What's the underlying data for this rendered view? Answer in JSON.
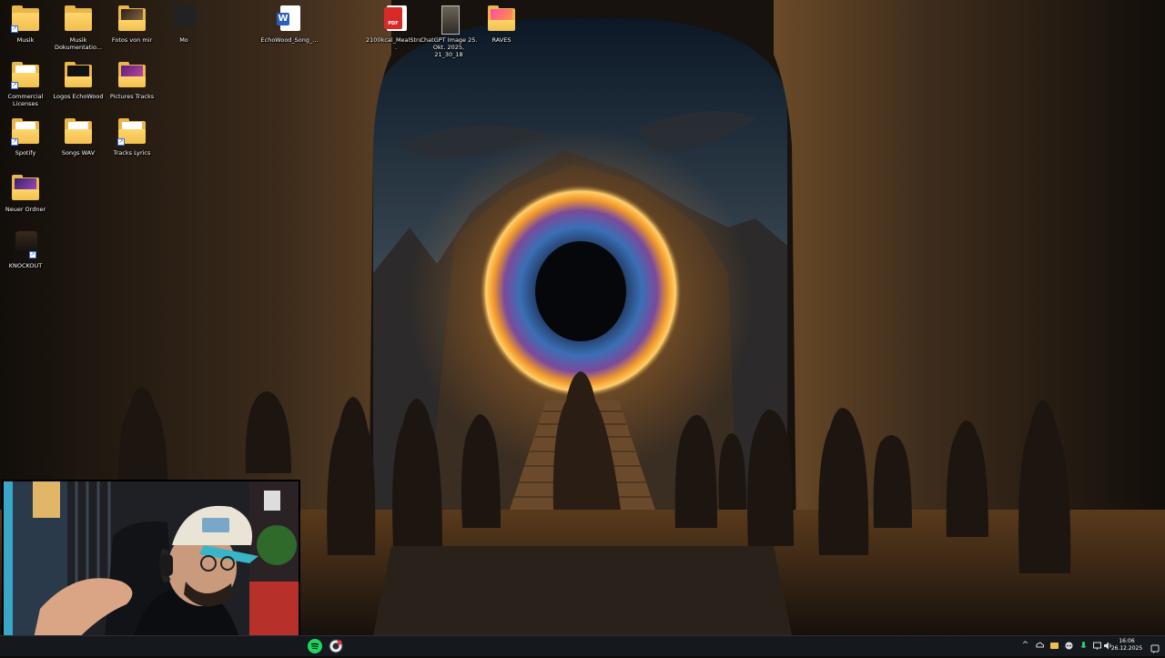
{
  "desktop": {
    "icons": [
      {
        "label": "Musik",
        "kind": "folder",
        "shortcut": true
      },
      {
        "label": "Musik Dokumentatio...",
        "kind": "folder"
      },
      {
        "label": "Fotos von mir",
        "kind": "folder-photo"
      },
      {
        "label": "Mo",
        "kind": "app-dark"
      },
      {
        "label": "EchoWood_Song_...",
        "kind": "word"
      },
      {
        "label": "2100kcal_MealStru...",
        "kind": "pdf"
      },
      {
        "label": "ChatGPT Image 25. Okt. 2025, 21_30_18",
        "kind": "image"
      },
      {
        "label": "RAVES",
        "kind": "folder-pink"
      },
      {
        "label": "Commercial Licenses",
        "kind": "folder",
        "shortcut": true
      },
      {
        "label": "Logos EchoWood",
        "kind": "folder-dark"
      },
      {
        "label": "Pictures Tracks",
        "kind": "folder-purple"
      },
      {
        "label": "Spotify",
        "kind": "folder",
        "shortcut": true
      },
      {
        "label": "Songs WAV",
        "kind": "folder"
      },
      {
        "label": "Tracks Lyrics",
        "kind": "folder",
        "shortcut": true
      },
      {
        "label": "Neuer Ordner",
        "kind": "folder-purple"
      },
      {
        "label": "KNOCKOUT",
        "kind": "app-knockout"
      }
    ]
  },
  "taskbar": {
    "apps": [
      {
        "name": "spotify",
        "color": "#1ed760"
      },
      {
        "name": "recorder",
        "color": "#e33b3b"
      }
    ],
    "tray": {
      "chevron": "^",
      "clock_time": "16:06",
      "clock_date": "26.12.2025"
    }
  },
  "colors": {
    "taskbar_bg": "#15181d",
    "folder": "#f1bf4e",
    "portal_glow": "#f39a2a",
    "portal_core": "#3b6fb6"
  }
}
